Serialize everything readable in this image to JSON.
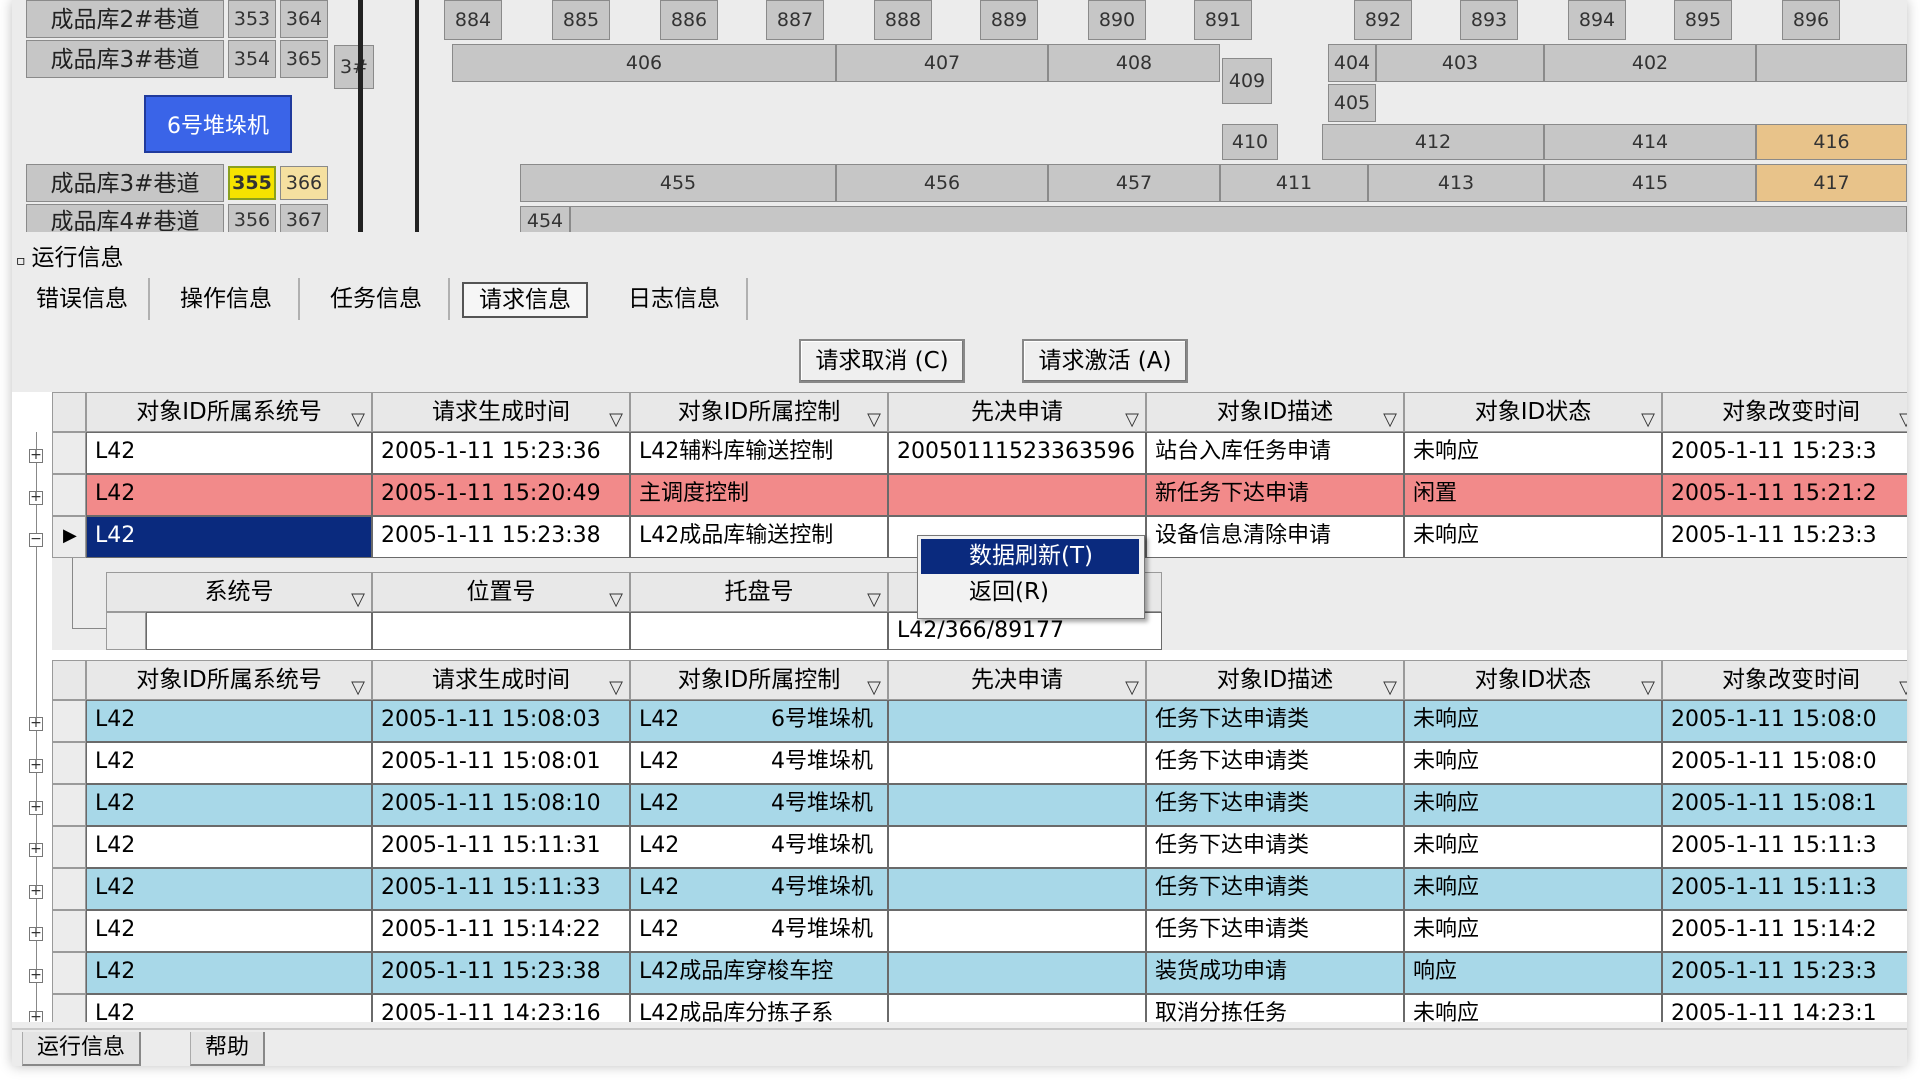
{
  "map": {
    "lanes": [
      {
        "label": "成品库2#巷道",
        "a": "353",
        "b": "364"
      },
      {
        "label": "成品库3#巷道",
        "a": "354",
        "b": "365"
      },
      {
        "label": "成品库3#巷道",
        "a": "355",
        "b": "366"
      },
      {
        "label": "成品库4#巷道",
        "a": "356",
        "b": "367"
      }
    ],
    "aisle_tag": "3#",
    "crane_label": "6号堆垛机",
    "top_slots": [
      "884",
      "885",
      "886",
      "887",
      "888",
      "889",
      "890",
      "891",
      "892",
      "893",
      "894",
      "895",
      "896"
    ],
    "row1": [
      "406",
      "407",
      "408",
      "409",
      "404",
      "403",
      "402"
    ],
    "row2": [
      "405"
    ],
    "row3": [
      "410",
      "412",
      "414",
      "416"
    ],
    "row4": [
      "455",
      "456",
      "457",
      "411",
      "413",
      "415",
      "417"
    ],
    "row5": [
      "454"
    ]
  },
  "panel": {
    "title": "运行信息",
    "collapse_glyph": "▫"
  },
  "tabs": [
    "错误信息",
    "操作信息",
    "任务信息",
    "请求信息",
    "日志信息"
  ],
  "active_tab": "请求信息",
  "buttons": {
    "cancel": "请求取消 (C)",
    "activate": "请求激活 (A)"
  },
  "grid": {
    "columns": [
      "对象ID所属系统号",
      "请求生成时间",
      "对象ID所属控制",
      "先决申请",
      "对象ID描述",
      "对象ID状态",
      "对象改变时间"
    ],
    "top_rows": [
      {
        "sys": "L42",
        "time": "2005-1-11 15:23:36",
        "ctrl": "L42辅料库输送控制",
        "pre": "20050111523363596",
        "desc": "站台入库任务申请",
        "state": "未响应",
        "changed": "2005-1-11 15:23:3"
      },
      {
        "sys": "L42",
        "time": "2005-1-11 15:20:49",
        "ctrl": "主调度控制",
        "pre": "",
        "desc": "新任务下达申请",
        "state": "闲置",
        "changed": "2005-1-11 15:21:2"
      },
      {
        "sys": "L42",
        "time": "2005-1-11 15:23:38",
        "ctrl": "L42成品库输送控制",
        "pre": "",
        "desc": "设备信息清除申请",
        "state": "未响应",
        "changed": "2005-1-11 15:23:3"
      }
    ],
    "sub_columns": [
      "系统号",
      "位置号",
      "托盘号"
    ],
    "sub_row_value": "L42/366/89177",
    "bottom_rows": [
      {
        "sys": "L42",
        "time": "2005-1-11 15:08:03",
        "ctrl": "L42",
        "ctrl2": "6号堆垛机",
        "desc": "任务下达申请类",
        "state": "未响应",
        "changed": "2005-1-11 15:08:0"
      },
      {
        "sys": "L42",
        "time": "2005-1-11 15:08:01",
        "ctrl": "L42",
        "ctrl2": "4号堆垛机",
        "desc": "任务下达申请类",
        "state": "未响应",
        "changed": "2005-1-11 15:08:0"
      },
      {
        "sys": "L42",
        "time": "2005-1-11 15:08:10",
        "ctrl": "L42",
        "ctrl2": "4号堆垛机",
        "desc": "任务下达申请类",
        "state": "未响应",
        "changed": "2005-1-11 15:08:1"
      },
      {
        "sys": "L42",
        "time": "2005-1-11 15:11:31",
        "ctrl": "L42",
        "ctrl2": "4号堆垛机",
        "desc": "任务下达申请类",
        "state": "未响应",
        "changed": "2005-1-11 15:11:3"
      },
      {
        "sys": "L42",
        "time": "2005-1-11 15:11:33",
        "ctrl": "L42",
        "ctrl2": "4号堆垛机",
        "desc": "任务下达申请类",
        "state": "未响应",
        "changed": "2005-1-11 15:11:3"
      },
      {
        "sys": "L42",
        "time": "2005-1-11 15:14:22",
        "ctrl": "L42",
        "ctrl2": "4号堆垛机",
        "desc": "任务下达申请类",
        "state": "未响应",
        "changed": "2005-1-11 15:14:2"
      },
      {
        "sys": "L42",
        "time": "2005-1-11 15:23:38",
        "ctrl": "L42成品库穿梭车控",
        "ctrl2": "",
        "desc": "装货成功申请",
        "state": "响应",
        "changed": "2005-1-11 15:23:3"
      },
      {
        "sys": "L42",
        "time": "2005-1-11 14:23:16",
        "ctrl": "L42成品库分拣子系",
        "ctrl2": "",
        "desc": "取消分拣任务",
        "state": "未响应",
        "changed": "2005-1-11 14:23:1"
      }
    ]
  },
  "context_menu": [
    "数据刷新(T)",
    "返回(R)"
  ],
  "bottom_tabs": [
    "运行信息",
    "帮助"
  ],
  "colors": {
    "alert_row": "#f28a8a",
    "selected_cell": "#0a2a7e",
    "alt_row": "#a8d8e8",
    "crane": "#3a64e8",
    "slot_orange": "#e8c38a",
    "highlight_yellow": "#f5e300"
  },
  "icons": {
    "filter": "funnel-icon",
    "expand": "plus-box-icon",
    "collapse": "minus-box-icon",
    "row_pointer": "triangle-right-icon"
  }
}
